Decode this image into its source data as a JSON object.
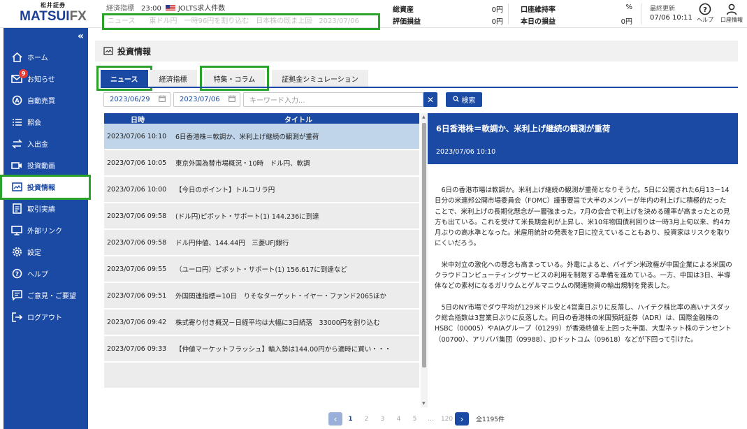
{
  "brand": {
    "top": "松井証券",
    "name": "MATSUI",
    "suffix": "FX"
  },
  "header": {
    "indicator_label": "経済指標",
    "indicator_time": "23:00",
    "indicator_name": "JOLTS求人件数",
    "ticker_label": "ニュース",
    "ticker_text": "東ドル円　一時96円を割り込む　日本株の既ま上回　2023/07/06",
    "assets_label": "総資産",
    "assets_value": "0円",
    "eval_label": "評価損益",
    "eval_value": "0円",
    "margin_label": "口座維持率",
    "margin_value": "%",
    "today_label": "本日の損益",
    "today_value": "0円",
    "updated_label": "最終更新",
    "updated_value": "07/06 10:11",
    "help_label": "ヘルプ",
    "account_label": "口座情報"
  },
  "sidebar": {
    "items": [
      {
        "label": "ホーム"
      },
      {
        "label": "お知らせ",
        "badge": "9"
      },
      {
        "label": "自動売買"
      },
      {
        "label": "照会"
      },
      {
        "label": "入出金"
      },
      {
        "label": "投資動画"
      },
      {
        "label": "投資情報"
      },
      {
        "label": "取引実績"
      },
      {
        "label": "外部リンク"
      },
      {
        "label": "設定"
      },
      {
        "label": "ヘルプ"
      },
      {
        "label": "ご意見・ご要望"
      },
      {
        "label": "ログアウト"
      }
    ]
  },
  "page": {
    "title": "投資情報"
  },
  "tabs": [
    {
      "label": "ニュース"
    },
    {
      "label": "経済指標"
    },
    {
      "label": "特集・コラム"
    },
    {
      "label": "証拠金シミュレーション"
    }
  ],
  "filters": {
    "date_from": "2023/06/29",
    "date_to": "2023/07/06",
    "keyword_placeholder": "キーワード入力...",
    "search_label": "検索"
  },
  "list": {
    "col_date": "日時",
    "col_title": "タイトル",
    "rows": [
      {
        "date": "2023/07/06 10:10",
        "title": "6日香港株＝軟調か、米利上げ継続の観測が重荷"
      },
      {
        "date": "2023/07/06 10:05",
        "title": "東京外国為替市場概況・10時　ドル円、軟調"
      },
      {
        "date": "2023/07/06 10:00",
        "title": "【今日のポイント】トルコリラ円"
      },
      {
        "date": "2023/07/06 09:58",
        "title": "(ドル円)ピボット・サポート(1) 144.236に到達"
      },
      {
        "date": "2023/07/06 09:58",
        "title": "ドル円仲値、144.44円　三菱UFJ銀行"
      },
      {
        "date": "2023/07/06 09:55",
        "title": "（ユーロ円）ピボット・サポート(1) 156.617に到達など"
      },
      {
        "date": "2023/07/06 09:51",
        "title": "外国関連指標＝10日　りそなターゲット・イヤー・ファンド2065ほか"
      },
      {
        "date": "2023/07/06 09:42",
        "title": "株式寄り付き概況－日経平均は大幅に3日続落　33000円を割り込む"
      },
      {
        "date": "2023/07/06 09:33",
        "title": "【仲値マーケットフラッシュ】輸入勢は144.00円から適時に買い・・・"
      },
      {
        "date": "",
        "title": ""
      }
    ]
  },
  "article": {
    "title": "6日香港株＝軟調か、米利上げ継続の観測が重荷",
    "date": "2023/07/06 10:10",
    "paragraphs": [
      "6日の香港市場は軟調か。米利上げ継続の観測が重荷となりそうだ。5日に公開された6月13－14日分の米連邦公開市場委員会（FOMC）議事要旨で大半のメンバーが年内の利上げに積極的だったことで、米利上げの長期化懸念が一層強まった。7月の会合で利上げを決める確率が高まったとの見方も出ている。これを受けて米長期金利が上昇し、米10年物国債利回りは一時3月上旬以来、約4カ月ぶりの高水準となった。米雇用統計の発表を7日に控えていることもあり、投資家はリスクを取りにくいだろう。",
      "米中対立の激化への懸念も高まっている。外電によると、バイデン米政権が中国企業による米国のクラウドコンピューティングサービスの利用を制限する準備を進めている。一方、中国は3日、半導体などの素材になるガリウムとゲルマニウムの関連物資の輸出規制を発表した。",
      "5日のNY市場でダウ平均が129米ドル安と4営業日ぶりに反落し、ハイテク株比率の高いナスダック総合指数は3営業日ぶりに反落した。同日の香港株の米国預託証券（ADR）は、国際金融株のHSBC（00005）やAIAグループ（01299）が香港終値を上回った半面、大型ネット株のテンセント（00700）、アリババ集団（09988）、JDドットコム（09618）などが下回って引けた。"
    ]
  },
  "pagination": {
    "pages": [
      "1",
      "2",
      "3",
      "4",
      "5",
      "…",
      "120"
    ],
    "current": "1",
    "total": "全1195件"
  },
  "colors": {
    "brand": "#1b4aa5",
    "highlight": "#2ba32b",
    "selected_row": "#c0d5ea"
  }
}
